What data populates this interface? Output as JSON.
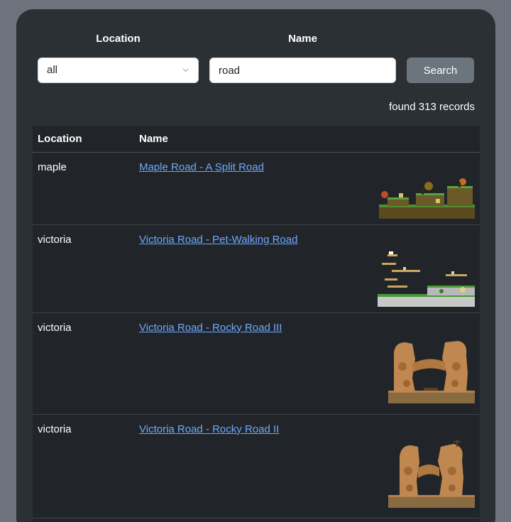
{
  "filters": {
    "location_label": "Location",
    "name_label": "Name",
    "location_value": "all",
    "name_value": "road",
    "search_label": "Search"
  },
  "results": {
    "count_text": "found 313 records",
    "columns": [
      "Location",
      "Name"
    ],
    "rows": [
      {
        "location": "maple",
        "name": "Maple Road - A Split Road",
        "thumb": "grassy-map-thumbnail"
      },
      {
        "location": "victoria",
        "name": "Victoria Road - Pet-Walking Road",
        "thumb": "platform-map-thumbnail"
      },
      {
        "location": "victoria",
        "name": "Victoria Road - Rocky Road III",
        "thumb": "rock-arch-map-thumbnail"
      },
      {
        "location": "victoria",
        "name": "Victoria Road - Rocky Road II",
        "thumb": "rock-arch-map-thumbnail"
      }
    ]
  },
  "colors": {
    "page_bg": "#6c737c",
    "panel_bg": "#2b3035",
    "table_bg": "#212529",
    "link": "#6ea8fe",
    "button": "#6c757d"
  }
}
